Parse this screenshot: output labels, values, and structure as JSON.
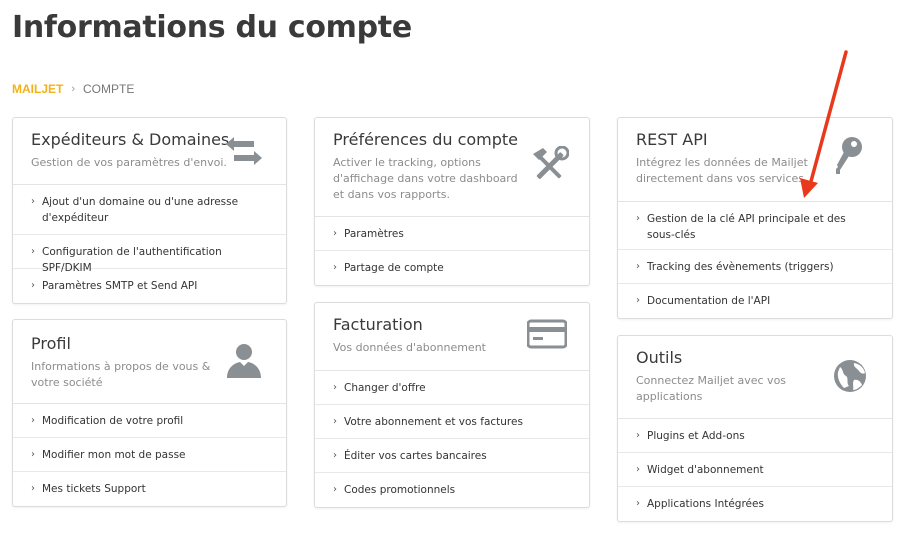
{
  "header": {
    "title": "Informations du compte"
  },
  "breadcrumb": {
    "brand": "MAILJET",
    "separator": "›",
    "current": "COMPTE"
  },
  "cards": {
    "expediteurs": {
      "title": "Expéditeurs & Domaines",
      "subtitle": "Gestion de vos paramètres d'envoi.",
      "icon": "swap-arrows-icon",
      "links": [
        "Ajout d'un domaine ou d'une adresse d'expéditeur",
        "Configuration de l'authentification SPF/DKIM",
        "Paramètres SMTP et Send API"
      ]
    },
    "profil": {
      "title": "Profil",
      "subtitle": "Informations à propos de vous & votre société",
      "icon": "user-icon",
      "links": [
        "Modification de votre profil",
        "Modifier mon mot de passe",
        "Mes tickets Support"
      ]
    },
    "preferences": {
      "title": "Préférences du compte",
      "subtitle": "Activer le tracking, options d'affichage dans votre dashboard et dans vos rapports.",
      "icon": "tools-icon",
      "links": [
        "Paramètres",
        "Partage de compte"
      ]
    },
    "facturation": {
      "title": "Facturation",
      "subtitle": "Vos données d'abonnement",
      "icon": "credit-card-icon",
      "links": [
        "Changer d'offre",
        "Votre abonnement et vos factures",
        "Éditer vos cartes bancaires",
        "Codes promotionnels"
      ]
    },
    "restapi": {
      "title": "REST API",
      "subtitle": "Intégrez les données de Mailjet directement dans vos services",
      "icon": "key-icon",
      "links": [
        "Gestion de la clé API principale et des sous-clés",
        "Tracking des évènements (triggers)",
        "Documentation de l'API"
      ]
    },
    "outils": {
      "title": "Outils",
      "subtitle": "Connectez Mailjet avec vos applications",
      "icon": "globe-icon",
      "links": [
        "Plugins et Add-ons",
        "Widget d'abonnement",
        "Applications Intégrées"
      ]
    }
  },
  "colors": {
    "brand": "#f3b21a",
    "icon": "#8a8f93",
    "annotation_arrow": "#e8391d"
  }
}
